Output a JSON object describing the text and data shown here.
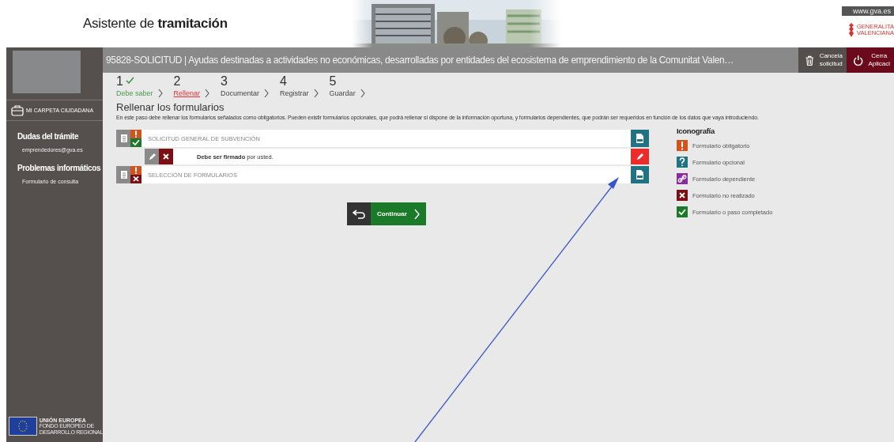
{
  "header": {
    "title": "Asistente de **tramitación**",
    "site_link": "www.gva.es",
    "logo_lines": [
      "GENERALITA",
      "VALENCIANA"
    ]
  },
  "sidebar": {
    "folder_link": "MI CARPETA CIUDADANA",
    "sections": [
      {
        "heading": "Dudas del trámite",
        "link": "emprendedores@gva.es"
      },
      {
        "heading": "Problemas informáticos",
        "link": "Formulario de consulta"
      }
    ],
    "eu_logo_lines": [
      "UNIÓN EUROPEA",
      "FONDO EUROPEO DE",
      "DESARROLLO REGIONAL"
    ]
  },
  "title_bar": {
    "title": "95828-SOLICITUD | Ayudas destinadas a actividades no económicas, desarrolladas por entidades del ecosistema de emprendimiento de la Comunitat Valen…",
    "buttons": [
      {
        "kind": "cancel",
        "lines": [
          "Cancela",
          "solicitud"
        ]
      },
      {
        "kind": "close",
        "lines": [
          "Cerra",
          "Aplicaci"
        ]
      }
    ]
  },
  "steps": [
    {
      "number": "1",
      "label": "Debe saber",
      "completed": true,
      "selected": false
    },
    {
      "number": "2",
      "label": "Rellenar",
      "completed": false,
      "selected": true
    },
    {
      "number": "3",
      "label": "Documentar",
      "completed": false,
      "selected": false
    },
    {
      "number": "4",
      "label": "Registrar",
      "completed": false,
      "selected": false
    },
    {
      "number": "5",
      "label": "Guardar",
      "completed": false,
      "selected": false
    }
  ],
  "section_title": "Rellenar los formularios",
  "description": "En este paso debe rellenar los formularios señalados como obligatorios. Pueden existir formularios opcionales, que podrá rellenar si dispone de la información oportuna, y formularios dependientes, que podrán ser requeridos en función de los datos que vaya introduciendo.",
  "forms": [
    {
      "title": "SOLICITUD GENERAL DE SUBVENCIÓN",
      "kind": "mandatory",
      "completed": true,
      "signature": {
        "text": "**Debe ser firmado** por usted.",
        "signed": false
      }
    },
    {
      "title": "SELECCIÓN DE FORMULARIOS",
      "kind": "mandatory",
      "completed": false
    }
  ],
  "continue_button": "Continuar",
  "legend": {
    "heading": "Iconografía",
    "items": [
      {
        "kind": "mandatory",
        "label": "Formulario obligatorio"
      },
      {
        "kind": "optional",
        "label": "Formulario opcional"
      },
      {
        "kind": "dependent",
        "label": "Formulario dependiente"
      },
      {
        "kind": "not_done",
        "label": "Formulario no realizado"
      },
      {
        "kind": "done",
        "label": "Formulario o paso completado"
      }
    ]
  }
}
